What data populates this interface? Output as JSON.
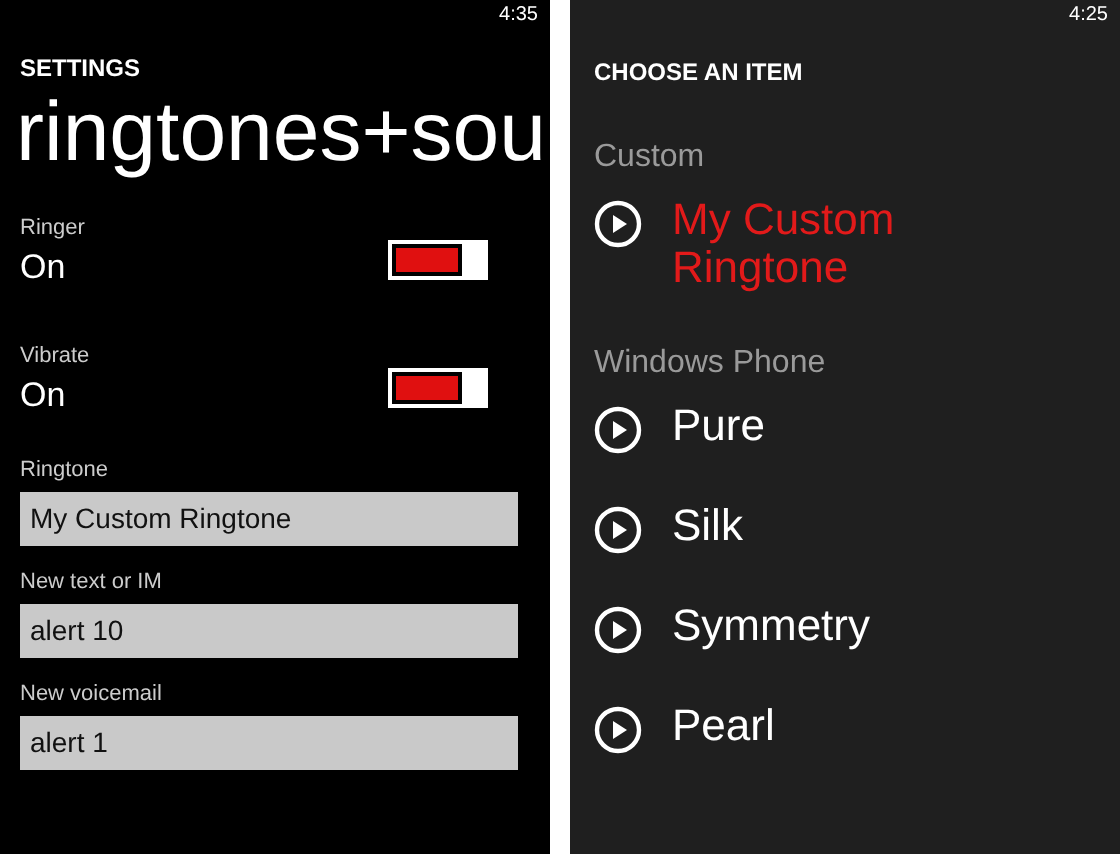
{
  "settings_screen": {
    "time": "4:35",
    "header": "SETTINGS",
    "title": "ringtones+sou",
    "toggles": [
      {
        "label": "Ringer",
        "value": "On",
        "on": true
      },
      {
        "label": "Vibrate",
        "value": "On",
        "on": true
      }
    ],
    "fields": [
      {
        "label": "Ringtone",
        "value": "My Custom Ringtone"
      },
      {
        "label": "New text or IM",
        "value": "alert 10"
      },
      {
        "label": "New voicemail",
        "value": "alert 1"
      }
    ]
  },
  "picker_screen": {
    "time": "4:25",
    "header": "CHOOSE AN ITEM",
    "groups": [
      {
        "label": "Custom",
        "items": [
          {
            "name": "My Custom Ringtone",
            "selected": true
          }
        ]
      },
      {
        "label": "Windows Phone",
        "items": [
          {
            "name": "Pure",
            "selected": false
          },
          {
            "name": "Silk",
            "selected": false
          },
          {
            "name": "Symmetry",
            "selected": false
          },
          {
            "name": "Pearl",
            "selected": false
          }
        ]
      }
    ]
  }
}
